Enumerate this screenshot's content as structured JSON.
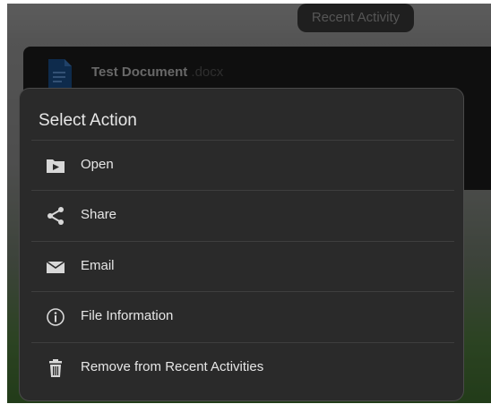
{
  "header": {
    "recent_activity_label": "Recent Activity"
  },
  "document": {
    "title": "Test Document",
    "extension": ".docx"
  },
  "dialog": {
    "title": "Select Action",
    "items": [
      {
        "label": "Open",
        "icon": "open-folder-icon"
      },
      {
        "label": "Share",
        "icon": "share-icon"
      },
      {
        "label": "Email",
        "icon": "email-icon"
      },
      {
        "label": "File Information",
        "icon": "info-icon"
      },
      {
        "label": "Remove from Recent Activities",
        "icon": "trash-icon"
      }
    ]
  }
}
